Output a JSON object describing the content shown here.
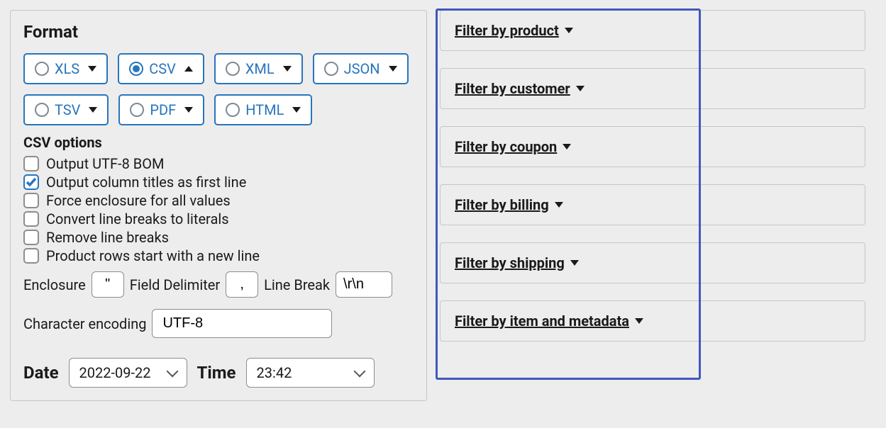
{
  "format": {
    "heading": "Format",
    "options": [
      {
        "label": "XLS",
        "selected": false,
        "expanded": false
      },
      {
        "label": "CSV",
        "selected": true,
        "expanded": true
      },
      {
        "label": "XML",
        "selected": false,
        "expanded": false
      },
      {
        "label": "JSON",
        "selected": false,
        "expanded": false
      },
      {
        "label": "TSV",
        "selected": false,
        "expanded": false
      },
      {
        "label": "PDF",
        "selected": false,
        "expanded": false
      },
      {
        "label": "HTML",
        "selected": false,
        "expanded": false
      }
    ]
  },
  "csv_options": {
    "heading": "CSV options",
    "checks": [
      {
        "label": "Output UTF-8 BOM",
        "checked": false
      },
      {
        "label": "Output column titles as first line",
        "checked": true
      },
      {
        "label": "Force enclosure for all values",
        "checked": false
      },
      {
        "label": "Convert line breaks to literals",
        "checked": false
      },
      {
        "label": "Remove line breaks",
        "checked": false
      },
      {
        "label": "Product rows start with a new line",
        "checked": false
      }
    ],
    "enclosure_label": "Enclosure",
    "enclosure_value": "\"",
    "delimiter_label": "Field Delimiter",
    "delimiter_value": ",",
    "linebreak_label": "Line Break",
    "linebreak_value": "\\r\\n",
    "encoding_label": "Character encoding",
    "encoding_value": "UTF-8"
  },
  "datetime": {
    "date_label": "Date",
    "date_value": "2022-09-22",
    "time_label": "Time",
    "time_value": "23:42"
  },
  "filters": [
    {
      "label": "Filter by product "
    },
    {
      "label": "Filter by customer "
    },
    {
      "label": "Filter by coupon "
    },
    {
      "label": "Filter by billing "
    },
    {
      "label": "Filter by shipping "
    },
    {
      "label": "Filter by item and metadata "
    }
  ]
}
